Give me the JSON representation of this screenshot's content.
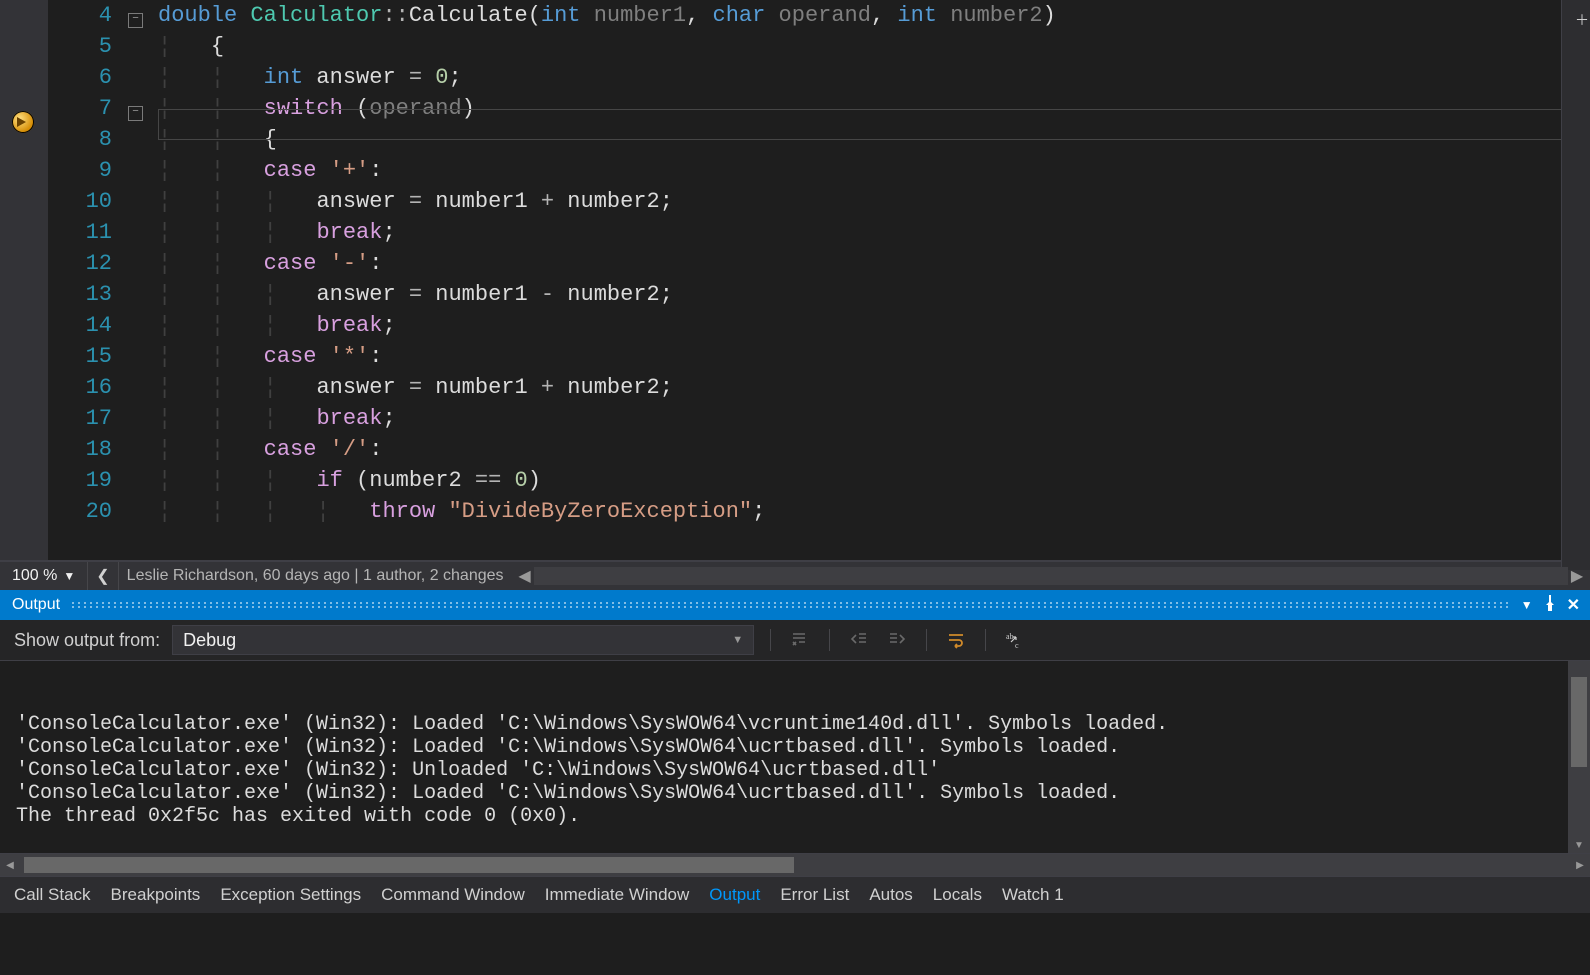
{
  "editor": {
    "zoom": "100 %",
    "blame": "Leslie Richardson, 60 days ago | 1 author, 2 changes",
    "breakpoint_line": 7,
    "lines": [
      {
        "n": 4,
        "fold": "-",
        "tokens": [
          [
            "kw",
            "double"
          ],
          [
            "txt",
            " "
          ],
          [
            "type",
            "Calculator"
          ],
          [
            "op",
            "::"
          ],
          [
            "txt",
            "Calculate"
          ],
          [
            "punct",
            "("
          ],
          [
            "kw",
            "int"
          ],
          [
            "txt",
            " "
          ],
          [
            "param",
            "number1"
          ],
          [
            "punct",
            ", "
          ],
          [
            "kw",
            "char"
          ],
          [
            "txt",
            " "
          ],
          [
            "param",
            "operand"
          ],
          [
            "punct",
            ", "
          ],
          [
            "kw",
            "int"
          ],
          [
            "txt",
            " "
          ],
          [
            "param",
            "number2"
          ],
          [
            "punct",
            ")"
          ]
        ]
      },
      {
        "n": 5,
        "indent": 1,
        "tokens": [
          [
            "punct",
            "{"
          ]
        ]
      },
      {
        "n": 6,
        "indent": 2,
        "tokens": [
          [
            "kw",
            "int"
          ],
          [
            "txt",
            " answer "
          ],
          [
            "op",
            "="
          ],
          [
            "txt",
            " "
          ],
          [
            "num",
            "0"
          ],
          [
            "punct",
            ";"
          ]
        ]
      },
      {
        "n": 7,
        "fold": "-",
        "indent": 2,
        "current": true,
        "tokens": [
          [
            "ctrl",
            "switch"
          ],
          [
            "txt",
            " "
          ],
          [
            "punct",
            "("
          ],
          [
            "param",
            "operand"
          ],
          [
            "punct",
            ")"
          ]
        ]
      },
      {
        "n": 8,
        "indent": 2,
        "tokens": [
          [
            "punct",
            "{"
          ]
        ]
      },
      {
        "n": 9,
        "indent": 2,
        "tokens": [
          [
            "ctrl",
            "case"
          ],
          [
            "txt",
            " "
          ],
          [
            "str",
            "'+'"
          ],
          [
            "punct",
            ":"
          ]
        ]
      },
      {
        "n": 10,
        "indent": 3,
        "tokens": [
          [
            "txt",
            "answer "
          ],
          [
            "op",
            "="
          ],
          [
            "txt",
            " number1 "
          ],
          [
            "op",
            "+"
          ],
          [
            "txt",
            " number2"
          ],
          [
            "punct",
            ";"
          ]
        ]
      },
      {
        "n": 11,
        "indent": 3,
        "tokens": [
          [
            "ctrl",
            "break"
          ],
          [
            "punct",
            ";"
          ]
        ]
      },
      {
        "n": 12,
        "indent": 2,
        "tokens": [
          [
            "ctrl",
            "case"
          ],
          [
            "txt",
            " "
          ],
          [
            "str",
            "'-'"
          ],
          [
            "punct",
            ":"
          ]
        ]
      },
      {
        "n": 13,
        "indent": 3,
        "tokens": [
          [
            "txt",
            "answer "
          ],
          [
            "op",
            "="
          ],
          [
            "txt",
            " number1 "
          ],
          [
            "op",
            "-"
          ],
          [
            "txt",
            " number2"
          ],
          [
            "punct",
            ";"
          ]
        ]
      },
      {
        "n": 14,
        "indent": 3,
        "tokens": [
          [
            "ctrl",
            "break"
          ],
          [
            "punct",
            ";"
          ]
        ]
      },
      {
        "n": 15,
        "indent": 2,
        "tokens": [
          [
            "ctrl",
            "case"
          ],
          [
            "txt",
            " "
          ],
          [
            "str",
            "'*'"
          ],
          [
            "punct",
            ":"
          ]
        ]
      },
      {
        "n": 16,
        "indent": 3,
        "tokens": [
          [
            "txt",
            "answer "
          ],
          [
            "op",
            "="
          ],
          [
            "txt",
            " number1 "
          ],
          [
            "op",
            "+"
          ],
          [
            "txt",
            " number2"
          ],
          [
            "punct",
            ";"
          ]
        ]
      },
      {
        "n": 17,
        "indent": 3,
        "tokens": [
          [
            "ctrl",
            "break"
          ],
          [
            "punct",
            ";"
          ]
        ]
      },
      {
        "n": 18,
        "indent": 2,
        "tokens": [
          [
            "ctrl",
            "case"
          ],
          [
            "txt",
            " "
          ],
          [
            "str",
            "'/'"
          ],
          [
            "punct",
            ":"
          ]
        ]
      },
      {
        "n": 19,
        "indent": 3,
        "tokens": [
          [
            "ctrl",
            "if"
          ],
          [
            "txt",
            " "
          ],
          [
            "punct",
            "("
          ],
          [
            "txt",
            "number2 "
          ],
          [
            "op",
            "=="
          ],
          [
            "txt",
            " "
          ],
          [
            "num",
            "0"
          ],
          [
            "punct",
            ")"
          ]
        ]
      },
      {
        "n": 20,
        "indent": 4,
        "tokens": [
          [
            "ctrl",
            "throw"
          ],
          [
            "txt",
            " "
          ],
          [
            "str",
            "\"DivideByZeroException\""
          ],
          [
            "punct",
            ";"
          ]
        ]
      }
    ]
  },
  "outputPanel": {
    "title": "Output",
    "show_from_label": "Show output from:",
    "source": "Debug",
    "lines": [
      "'ConsoleCalculator.exe' (Win32): Loaded 'C:\\Windows\\SysWOW64\\vcruntime140d.dll'. Symbols loaded.",
      "'ConsoleCalculator.exe' (Win32): Loaded 'C:\\Windows\\SysWOW64\\ucrtbased.dll'. Symbols loaded.",
      "'ConsoleCalculator.exe' (Win32): Unloaded 'C:\\Windows\\SysWOW64\\ucrtbased.dll'",
      "'ConsoleCalculator.exe' (Win32): Loaded 'C:\\Windows\\SysWOW64\\ucrtbased.dll'. Symbols loaded.",
      "The thread 0x2f5c has exited with code 0 (0x0)."
    ]
  },
  "toolTabs": {
    "items": [
      "Call Stack",
      "Breakpoints",
      "Exception Settings",
      "Command Window",
      "Immediate Window",
      "Output",
      "Error List",
      "Autos",
      "Locals",
      "Watch 1"
    ],
    "active": "Output"
  }
}
